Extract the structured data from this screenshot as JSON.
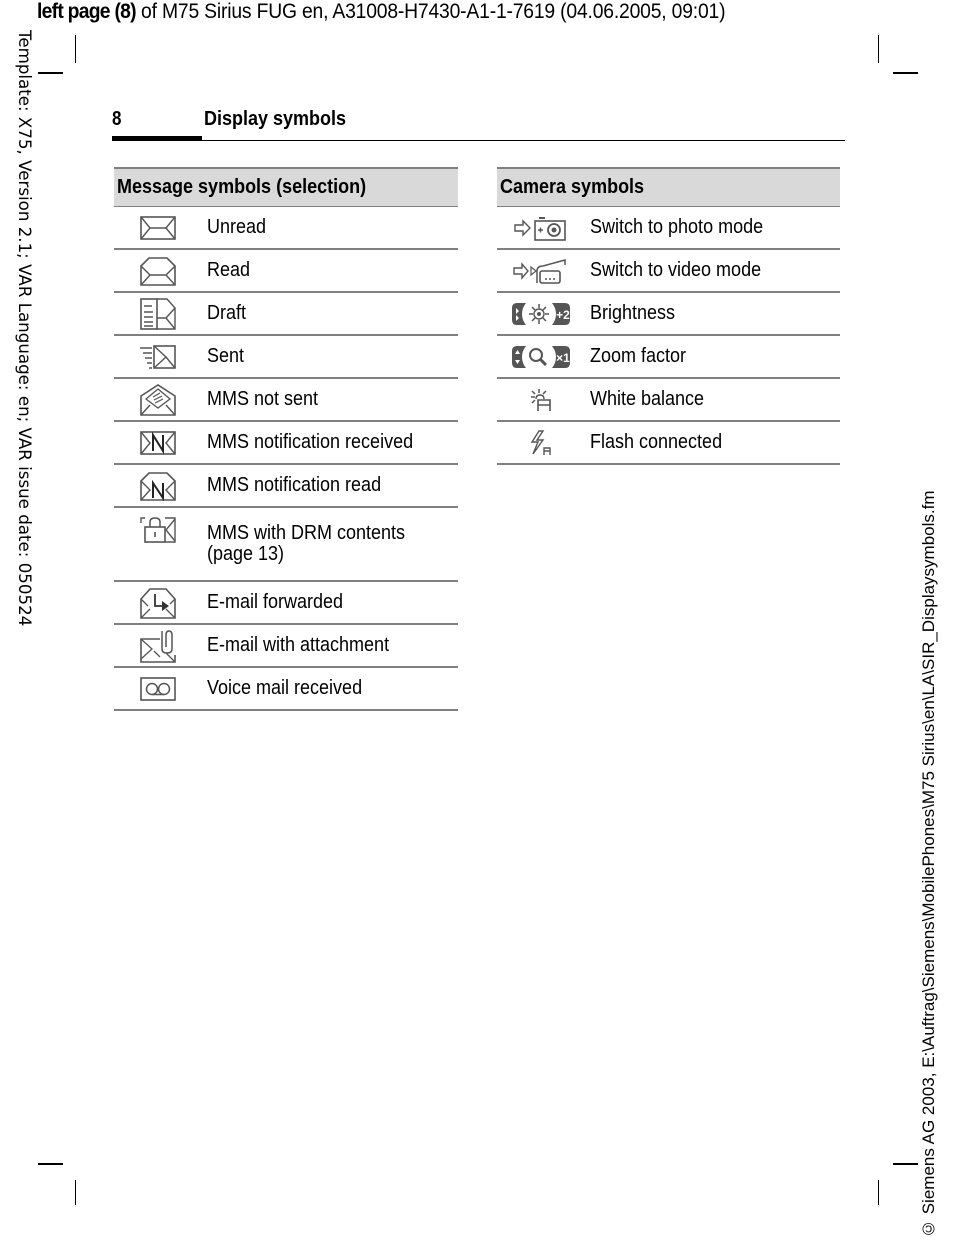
{
  "proof_header": {
    "bold_part": "left page (8)",
    "rest": " of M75 Sirius FUG en, A31008-H7430-A1-1-7619 (04.06.2005, 09:01)"
  },
  "side_left_text": "Template: X75, Version 2.1; VAR Language: en; VAR issue date: 050524",
  "side_right_text": "© Siemens AG 2003, E:\\Auftrag\\Siemens\\MobilePhones\\M75 Sirius\\en\\LA\\SIR_Displaysymbols.fm",
  "page": {
    "number": "8",
    "title": "Display symbols"
  },
  "message_table": {
    "header": "Message symbols (selection)",
    "rows": [
      {
        "icon": "envelope-closed-icon",
        "label": "Unread"
      },
      {
        "icon": "envelope-open-icon",
        "label": "Read"
      },
      {
        "icon": "draft-icon",
        "label": "Draft"
      },
      {
        "icon": "sent-icon",
        "label": "Sent"
      },
      {
        "icon": "mms-not-sent-icon",
        "label": "MMS not sent"
      },
      {
        "icon": "mms-notification-received-icon",
        "label": "MMS notification received"
      },
      {
        "icon": "mms-notification-read-icon",
        "label": "MMS notification read"
      },
      {
        "icon": "mms-drm-icon",
        "label": "MMS with DRM contents",
        "label2": "(page 13)"
      },
      {
        "icon": "email-forwarded-icon",
        "label": "E-mail forwarded"
      },
      {
        "icon": "email-attachment-icon",
        "label": "E-mail with attachment"
      },
      {
        "icon": "voicemail-icon",
        "label": "Voice mail received"
      }
    ]
  },
  "camera_table": {
    "header": "Camera symbols",
    "rows": [
      {
        "icon": "switch-photo-mode-icon",
        "label": "Switch to photo mode"
      },
      {
        "icon": "switch-video-mode-icon",
        "label": "Switch to video mode"
      },
      {
        "icon": "brightness-icon",
        "label": "Brightness",
        "icon_text": "+2"
      },
      {
        "icon": "zoom-factor-icon",
        "label": "Zoom factor",
        "icon_text": "×1"
      },
      {
        "icon": "white-balance-icon",
        "label": "White balance",
        "icon_text": "A"
      },
      {
        "icon": "flash-connected-icon",
        "label": "Flash connected",
        "icon_text": "A"
      }
    ]
  }
}
